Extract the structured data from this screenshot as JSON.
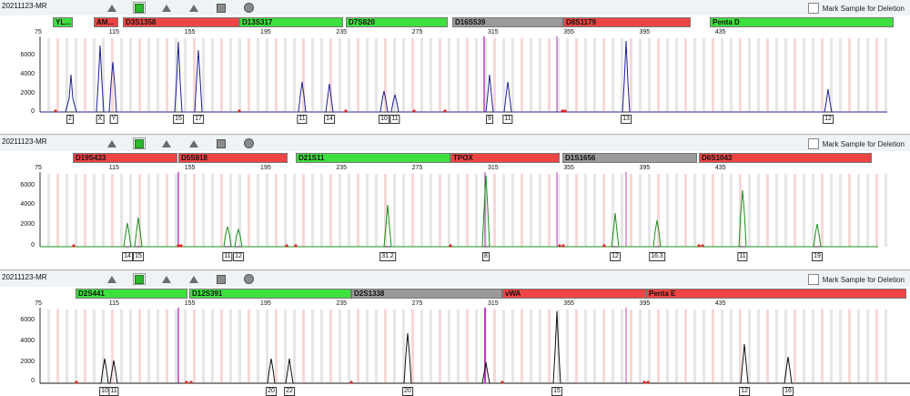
{
  "common": {
    "mark_label": "Mark Sample for Deletion",
    "x_ticks": [
      "75",
      "115",
      "155",
      "195",
      "235",
      "275",
      "315",
      "355",
      "395",
      "435"
    ],
    "y_ticks": [
      "6000",
      "4000",
      "2000",
      "0"
    ]
  },
  "panels": [
    {
      "sample": "20211123-MR",
      "color": "#1f1f8f",
      "loci": [
        {
          "name": "YL...",
          "status": "green"
        },
        {
          "name": "AM...",
          "status": "red"
        },
        {
          "name": "D3S1358",
          "status": "red"
        },
        {
          "name": "D13S317",
          "status": "green"
        },
        {
          "name": "D7S820",
          "status": "green"
        },
        {
          "name": "D16S539",
          "status": "gray"
        },
        {
          "name": "D8S1179",
          "status": "red"
        },
        {
          "name": "Penta D",
          "status": "green"
        }
      ],
      "alleles": [
        "2",
        "X",
        "Y",
        "15",
        "17",
        "11",
        "14",
        "10",
        "11",
        "9",
        "11",
        "13",
        "12"
      ]
    },
    {
      "sample": "20211123-MR",
      "color": "#1a8f1a",
      "loci": [
        {
          "name": "D19S433",
          "status": "red"
        },
        {
          "name": "D5S818",
          "status": "red"
        },
        {
          "name": "D21S11",
          "status": "green"
        },
        {
          "name": "TPOX",
          "status": "red"
        },
        {
          "name": "D1S1656",
          "status": "gray"
        },
        {
          "name": "D6S1043",
          "status": "red"
        }
      ],
      "alleles": [
        "14",
        "15",
        "11",
        "12",
        "31.2",
        "8",
        "12",
        "16.3",
        "11",
        "19"
      ]
    },
    {
      "sample": "20211123-MR",
      "color": "#111111",
      "loci": [
        {
          "name": "D2S441",
          "status": "green"
        },
        {
          "name": "D12S391",
          "status": "green"
        },
        {
          "name": "D2S1338",
          "status": "gray"
        },
        {
          "name": "vWA",
          "status": "red"
        },
        {
          "name": "Penta E",
          "status": "red"
        }
      ],
      "alleles": [
        "10",
        "11",
        "20",
        "22",
        "20",
        "15",
        "12",
        "16"
      ]
    }
  ],
  "status_colors": {
    "green": "#3ee03e",
    "red": "#ee4444",
    "gray": "#9a9a9a"
  }
}
